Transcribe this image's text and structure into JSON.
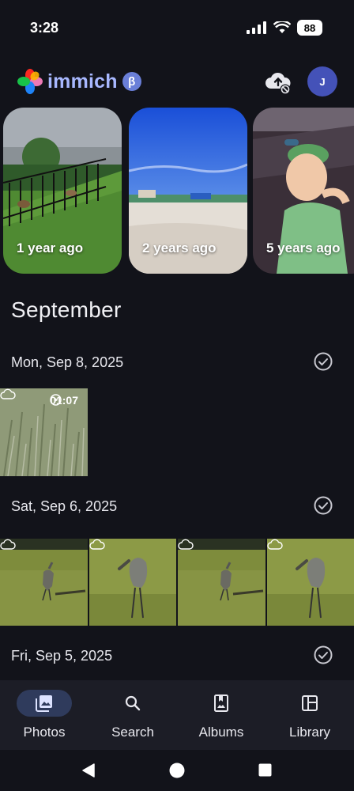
{
  "status_bar": {
    "time": "3:28",
    "battery": "88"
  },
  "header": {
    "app_name": "immich",
    "beta_badge": "β",
    "avatar_initial": "J"
  },
  "memories": [
    {
      "label": "1 year ago"
    },
    {
      "label": "2 years ago"
    },
    {
      "label": "5 years ago"
    }
  ],
  "timeline": {
    "month": "September",
    "groups": [
      {
        "date": "Mon, Sep 8, 2025",
        "video_duration": "01:07"
      },
      {
        "date": "Sat, Sep 6, 2025"
      },
      {
        "date": "Fri, Sep 5, 2025"
      }
    ]
  },
  "bottom_nav": [
    {
      "label": "Photos",
      "icon": "photos-icon",
      "active": true
    },
    {
      "label": "Search",
      "icon": "search-icon",
      "active": false
    },
    {
      "label": "Albums",
      "icon": "albums-icon",
      "active": false
    },
    {
      "label": "Library",
      "icon": "library-icon",
      "active": false
    }
  ],
  "colors": {
    "background": "#12131a",
    "accent": "#a8b8ff",
    "nav_active": "#2f3b5c"
  }
}
